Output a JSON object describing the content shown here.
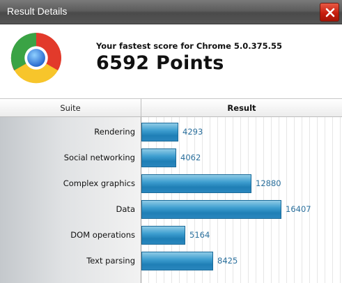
{
  "window": {
    "title": "Result Details",
    "close_label": "close"
  },
  "header": {
    "subtitle": "Your fastest score for Chrome 5.0.375.55",
    "score": "6592 Points"
  },
  "table": {
    "columns": [
      "Suite",
      "Result"
    ],
    "rows": [
      {
        "label": "Rendering",
        "value": "4293"
      },
      {
        "label": "Social networking",
        "value": "4062"
      },
      {
        "label": "Complex graphics",
        "value": "12880"
      },
      {
        "label": "Data",
        "value": "16407"
      },
      {
        "label": "DOM operations",
        "value": "5164"
      },
      {
        "label": "Text parsing",
        "value": "8425"
      }
    ]
  },
  "chart_data": {
    "type": "bar",
    "orientation": "horizontal",
    "categories": [
      "Rendering",
      "Social networking",
      "Complex graphics",
      "Data",
      "DOM operations",
      "Text parsing"
    ],
    "values": [
      4293,
      4062,
      12880,
      16407,
      5164,
      8425
    ],
    "xlabel": "Result",
    "ylabel": "Suite",
    "xlim": [
      0,
      16407
    ]
  },
  "colors": {
    "bar": "#2a86bd",
    "value_text": "#2a6f9c",
    "close": "#c81e0e"
  },
  "icons": {
    "logo": "chrome-logo",
    "close": "close-icon"
  }
}
